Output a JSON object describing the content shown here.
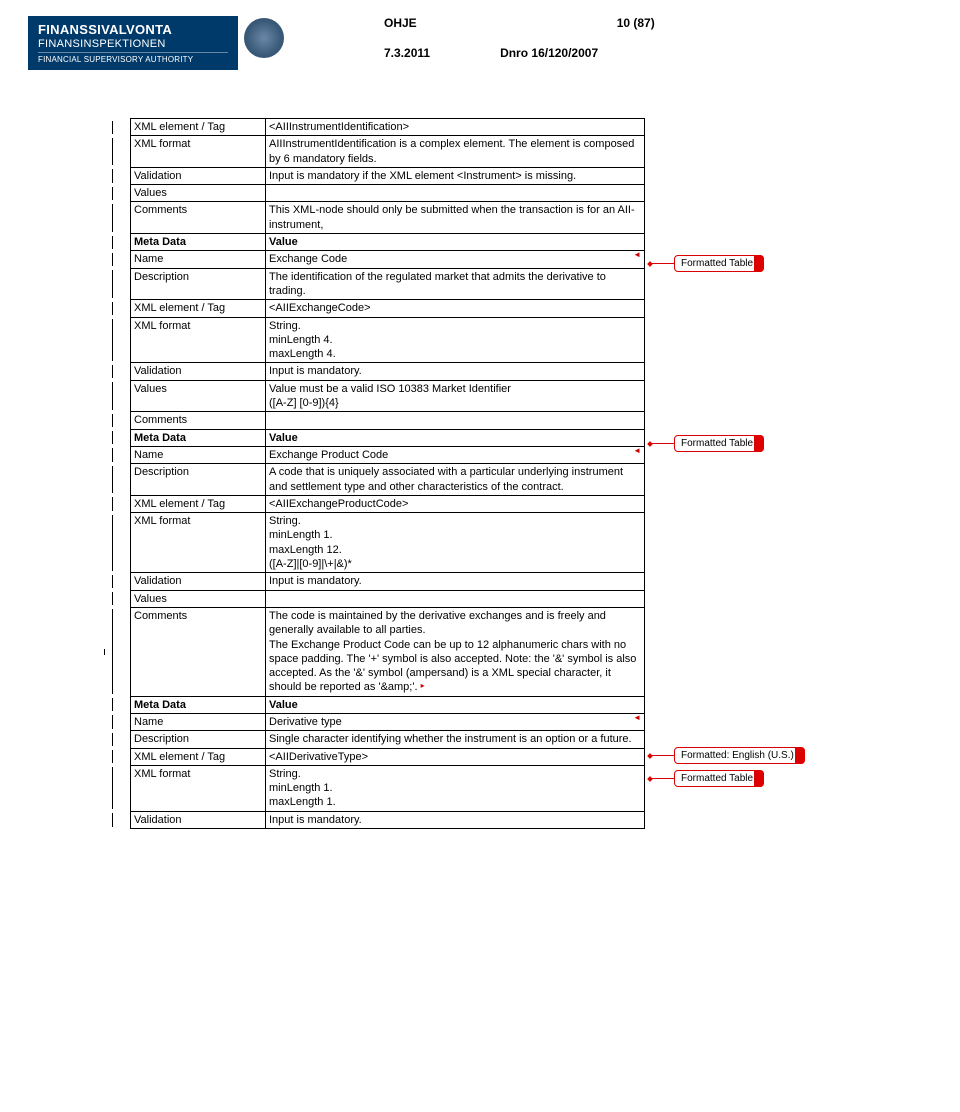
{
  "header": {
    "logo_line1": "FINANSSIVALVONTA",
    "logo_line2": "FINANSINSPEKTIONEN",
    "logo_line3": "FINANCIAL SUPERVISORY AUTHORITY",
    "doc_type": "OHJE",
    "page_num": "10 (87)",
    "date": "7.3.2011",
    "dnro": "Dnro 16/120/2007"
  },
  "callouts": {
    "formatted_table": "Formatted Table",
    "formatted_english": "Formatted: English (U.S.)"
  },
  "rows": [
    {
      "k": "XML element / Tag",
      "v": "<AIIInstrumentIdentification>"
    },
    {
      "k": "XML format",
      "v": "AIIInstrumentIdentification is a complex element. The element is composed by 6 mandatory fields."
    },
    {
      "k": "Validation",
      "v": "Input is mandatory if the XML element <Instrument> is missing."
    },
    {
      "k": "Values",
      "v": ""
    },
    {
      "k": "Comments",
      "v": "This XML-node should only be submitted when the transaction is for an AII-instrument,"
    },
    {
      "k": "Meta Data",
      "v": "Value",
      "bold": true
    },
    {
      "k": "Name",
      "v": "Exchange Code",
      "marker": true
    },
    {
      "k": "Description",
      "v": "The identification of the regulated market that admits the derivative to trading."
    },
    {
      "k": "XML element / Tag",
      "v": "<AIIExchangeCode>"
    },
    {
      "k": "XML format",
      "v": "String.\nminLength 4.\nmaxLength 4."
    },
    {
      "k": "Validation",
      "v": "Input is mandatory."
    },
    {
      "k": "Values",
      "v": "Value must be a valid ISO 10383 Market Identifier\n([A-Z] [0-9]){4}"
    },
    {
      "k": "Comments",
      "v": ""
    },
    {
      "k": "Meta Data",
      "v": "Value",
      "bold": true
    },
    {
      "k": "Name",
      "v": "Exchange Product Code",
      "marker": true
    },
    {
      "k": "Description",
      "v": "A code that is uniquely associated with a particular underlying instrument and settlement type and other characteristics of the contract."
    },
    {
      "k": "XML element / Tag",
      "v": "<AIIExchangeProductCode>"
    },
    {
      "k": "XML format",
      "v": "String.\nminLength 1.\nmaxLength 12.\n([A-Z]|[0-9]|\\+|&)*"
    },
    {
      "k": "Validation",
      "v": "Input is mandatory."
    },
    {
      "k": "Values",
      "v": ""
    },
    {
      "k": "Comments",
      "v": "The code is maintained by the derivative exchanges and is freely and generally available to all parties.\nThe Exchange Product Code can be up to 12 alphanumeric chars with no space padding. The '+' symbol is also accepted. Note: the '&' symbol is also accepted. As the '&' symbol (ampersand) is a XML special character, it should be reported as '&amp;'.",
      "endmarker": true
    },
    {
      "k": "Meta Data",
      "v": "Value",
      "bold": true
    },
    {
      "k": "Name",
      "v": "Derivative type",
      "marker": true
    },
    {
      "k": "Description",
      "v": "Single character identifying whether the instrument is an option or a future."
    },
    {
      "k": "XML element / Tag",
      "v": "<AIIDerivativeType>"
    },
    {
      "k": "XML format",
      "v": "String.\nminLength 1.\nmaxLength 1."
    },
    {
      "k": "Validation",
      "v": "Input is mandatory."
    }
  ]
}
